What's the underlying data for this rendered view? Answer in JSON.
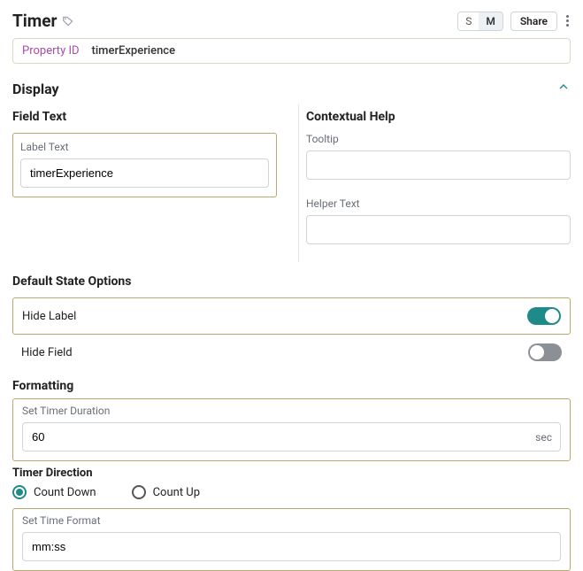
{
  "header": {
    "title": "Timer",
    "size_s": "S",
    "size_m": "M",
    "share": "Share"
  },
  "property": {
    "label": "Property ID",
    "value": "timerExperience"
  },
  "display": {
    "section_title": "Display",
    "field_text": {
      "heading": "Field Text",
      "label_text_label": "Label Text",
      "label_text_value": "timerExperience"
    },
    "contextual_help": {
      "heading": "Contextual Help",
      "tooltip_label": "Tooltip",
      "tooltip_value": "",
      "helper_label": "Helper Text",
      "helper_value": ""
    },
    "default_state": {
      "heading": "Default State Options",
      "hide_label_label": "Hide Label",
      "hide_label_on": true,
      "hide_field_label": "Hide Field",
      "hide_field_on": false
    },
    "formatting": {
      "heading": "Formatting",
      "duration_label": "Set Timer Duration",
      "duration_value": "60",
      "duration_unit": "sec",
      "direction_heading": "Timer Direction",
      "count_down": "Count Down",
      "count_up": "Count Up",
      "direction_selected": "down",
      "time_format_label": "Set Time Format",
      "time_format_value": "mm:ss"
    }
  }
}
